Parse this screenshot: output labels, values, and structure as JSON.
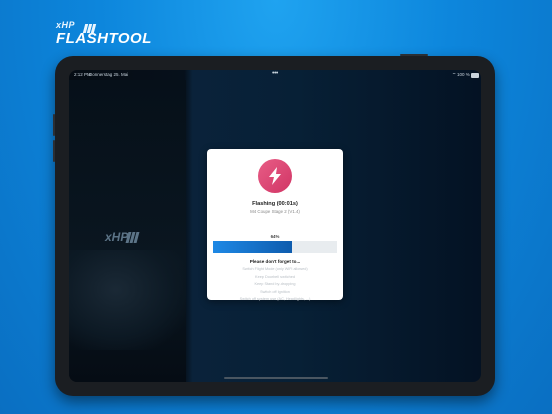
{
  "brand": {
    "tag": "xHP",
    "name": "FLASHTOOL"
  },
  "status_bar": {
    "time": "2:12 PM",
    "date": "Donnerstag 25. Mai",
    "dots": "•••",
    "wifi": "⌔",
    "battery": "100 %",
    "battery_level": 1.0
  },
  "background": {
    "logo": "xHP"
  },
  "modal": {
    "icon": "lightning-icon",
    "title": "Flashing (00:01s)",
    "subtitle": "M4 Coupe Stage 2 (V1.4)",
    "progress_label": "64%",
    "progress_value": 0.64,
    "heading": "Please don't forget to...",
    "tips": [
      "Switch Flight Mode (only WiFi allowed)",
      "Keep Doorbell switched",
      "Keep Stand by-dropping",
      "Switch off Ignition",
      "Switch off system use (AC, Headlights, ...)"
    ]
  },
  "colors": {
    "accent": "#1e88e5",
    "icon_bg": "#e04f7a",
    "bg": "#0d86dc"
  }
}
